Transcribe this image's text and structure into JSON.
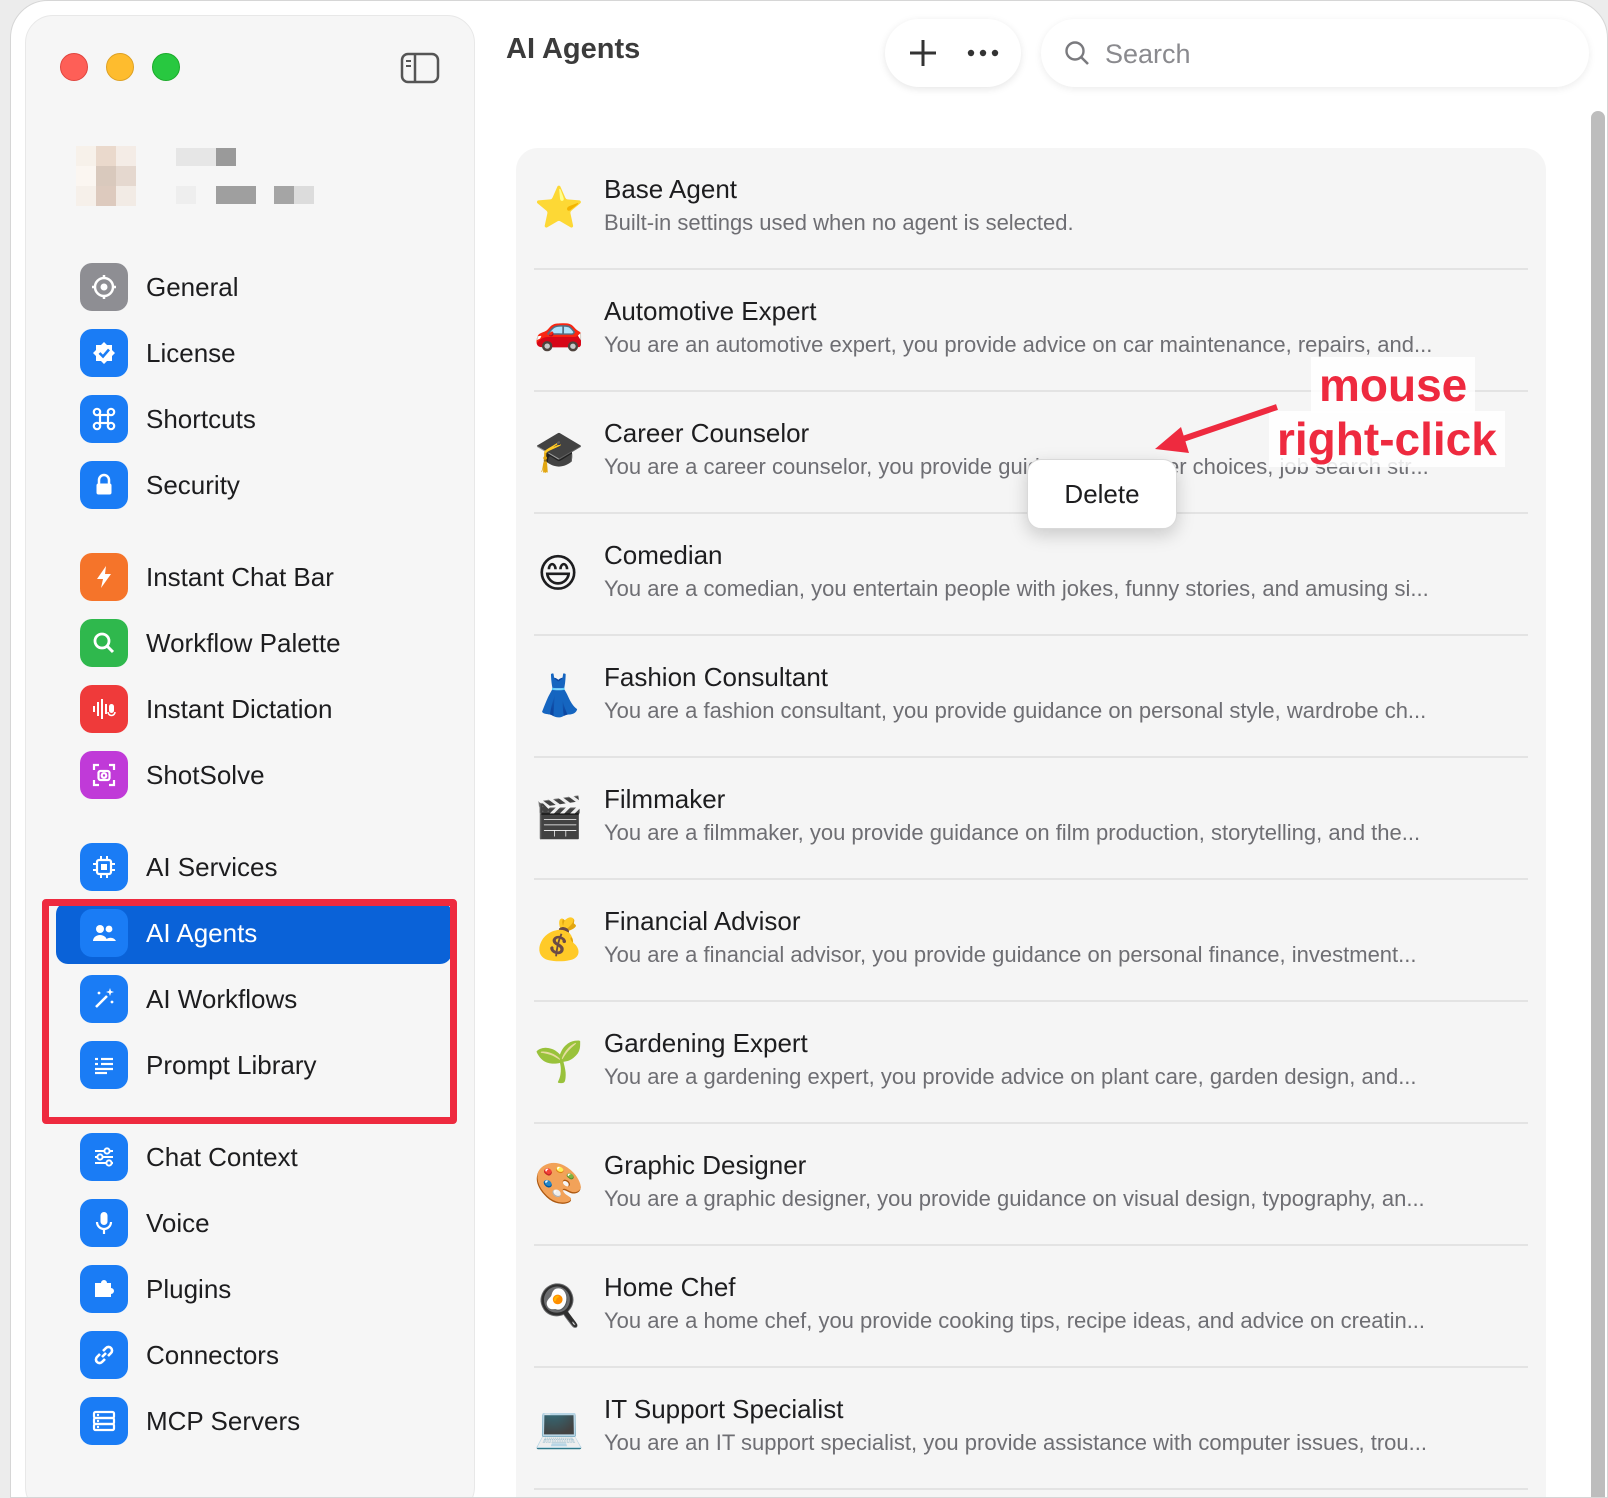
{
  "window": {
    "title": "AI Agents"
  },
  "toolbar": {
    "add_icon": "plus-icon",
    "more_icon": "ellipsis-icon"
  },
  "search": {
    "placeholder": "Search",
    "value": ""
  },
  "sidebar": {
    "items": [
      {
        "label": "General",
        "icon": "gear-icon",
        "color": "#8e8e93"
      },
      {
        "label": "License",
        "icon": "checkmark-seal-icon",
        "color": "#1a7cf5"
      },
      {
        "label": "Shortcuts",
        "icon": "command-icon",
        "color": "#1a7cf5"
      },
      {
        "label": "Security",
        "icon": "lock-icon",
        "color": "#1a7cf5"
      },
      {
        "label": "Instant Chat Bar",
        "icon": "bolt-icon",
        "color": "#f5742a"
      },
      {
        "label": "Workflow Palette",
        "icon": "magnifier-icon",
        "color": "#2fb84d"
      },
      {
        "label": "Instant Dictation",
        "icon": "waveform-mic-icon",
        "color": "#ef3a3a"
      },
      {
        "label": "ShotSolve",
        "icon": "camera-viewfinder-icon",
        "color": "#c03ad8"
      },
      {
        "label": "AI Services",
        "icon": "cpu-icon",
        "color": "#1a7cf5"
      },
      {
        "label": "AI Agents",
        "icon": "people-icon",
        "color": "#1a7cf5",
        "active": true
      },
      {
        "label": "AI Workflows",
        "icon": "magic-wand-icon",
        "color": "#1a7cf5"
      },
      {
        "label": "Prompt Library",
        "icon": "text-list-icon",
        "color": "#1a7cf5"
      },
      {
        "label": "Chat Context",
        "icon": "sliders-icon",
        "color": "#1a7cf5"
      },
      {
        "label": "Voice",
        "icon": "microphone-icon",
        "color": "#1a7cf5"
      },
      {
        "label": "Plugins",
        "icon": "puzzle-icon",
        "color": "#1a7cf5"
      },
      {
        "label": "Connectors",
        "icon": "link-icon",
        "color": "#1a7cf5"
      },
      {
        "label": "MCP Servers",
        "icon": "server-icon",
        "color": "#1a7cf5"
      }
    ]
  },
  "agents": [
    {
      "emoji": "⭐",
      "name": "Base Agent",
      "desc": "Built-in settings used when no agent is selected."
    },
    {
      "emoji": "🚗",
      "name": "Automotive Expert",
      "desc": "You are an automotive expert, you provide advice on car maintenance, repairs, and..."
    },
    {
      "emoji": "🎓",
      "name": "Career Counselor",
      "desc": "You are a career counselor, you provide guidance on career choices, job search str..."
    },
    {
      "emoji": "😄",
      "name": "Comedian",
      "desc": "You are a comedian, you entertain people with jokes, funny stories, and amusing si..."
    },
    {
      "emoji": "👗",
      "name": "Fashion Consultant",
      "desc": "You are a fashion consultant, you provide guidance on personal style, wardrobe ch..."
    },
    {
      "emoji": "🎬",
      "name": "Filmmaker",
      "desc": "You are a filmmaker, you provide guidance on film production, storytelling, and the..."
    },
    {
      "emoji": "💰",
      "name": "Financial Advisor",
      "desc": "You are a financial advisor, you provide guidance on personal finance, investment..."
    },
    {
      "emoji": "🌱",
      "name": "Gardening Expert",
      "desc": "You are a gardening expert, you provide advice on plant care, garden design, and..."
    },
    {
      "emoji": "🎨",
      "name": "Graphic Designer",
      "desc": "You are a graphic designer, you provide guidance on visual design, typography, an..."
    },
    {
      "emoji": "🍳",
      "name": "Home Chef",
      "desc": "You are a home chef, you provide cooking tips, recipe ideas, and advice on creatin..."
    },
    {
      "emoji": "💻",
      "name": "IT Support Specialist",
      "desc": "You are an IT support specialist, you provide assistance with computer issues, trou..."
    }
  ],
  "context_menu": {
    "items": [
      "Delete"
    ]
  },
  "annotation": {
    "line1": "mouse",
    "line2": "right-click",
    "color": "#ee2a3f"
  }
}
